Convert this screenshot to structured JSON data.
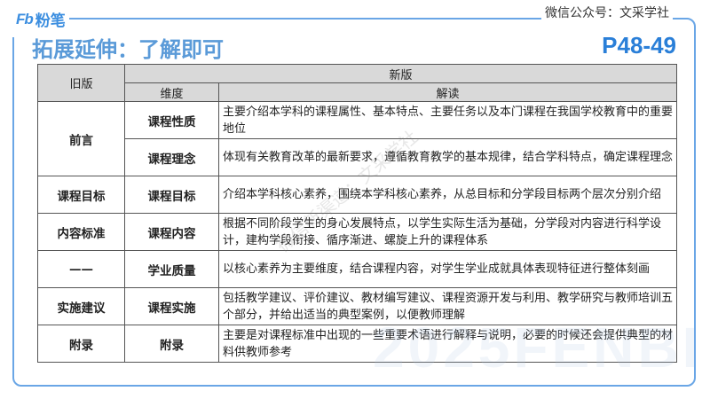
{
  "header": {
    "logo_text": "粉笔",
    "logo_mark": "Fb",
    "wechat": "微信公众号：文采学社",
    "title": "拓展延伸：了解即可",
    "page_ref": "P48-49"
  },
  "watermarks": [
    "微信新渠道：文采学社",
    "2025FENBI"
  ],
  "table": {
    "headers": {
      "old": "旧版",
      "new": "新版",
      "dimension": "维度",
      "interpretation": "解读"
    },
    "rows": [
      {
        "old": "前言",
        "dimension": "课程性质",
        "desc": "主要介绍本学科的课程属性、基本特点、主要任务以及本门课程在我国学校教育中的重要地位"
      },
      {
        "old": "",
        "dimension": "课程理念",
        "desc": "体现有关教育改革的最新要求，遵循教育教学的基本规律，结合学科特点，确定课程理念"
      },
      {
        "old": "课程目标",
        "dimension": "课程目标",
        "desc": "介绍本学科核心素养，围绕本学科核心素养，从总目标和分学段目标两个层次分别介绍"
      },
      {
        "old": "内容标准",
        "dimension": "课程内容",
        "desc": "根据不同阶段学生的身心发展特点，以学生实际生活为基础，分学段对内容进行科学设计，建构学段衔接、循序渐进、螺旋上升的课程体系"
      },
      {
        "old": "——",
        "dimension": "学业质量",
        "desc": "以核心素养为主要维度，结合课程内容，对学生学业成就具体表现特征进行整体刻画"
      },
      {
        "old": "实施建议",
        "dimension": "课程实施",
        "desc": "包括教学建议、评价建议、教材编写建议、课程资源开发与利用、教学研究与教师培训五个部分，并给出适当的典型案例，以便教师理解"
      },
      {
        "old": "附录",
        "dimension": "附录",
        "desc": "主要是对课程标准中出现的一些重要术语进行解释与说明，必要的时候还会提供典型的材料供教师参考"
      }
    ]
  }
}
